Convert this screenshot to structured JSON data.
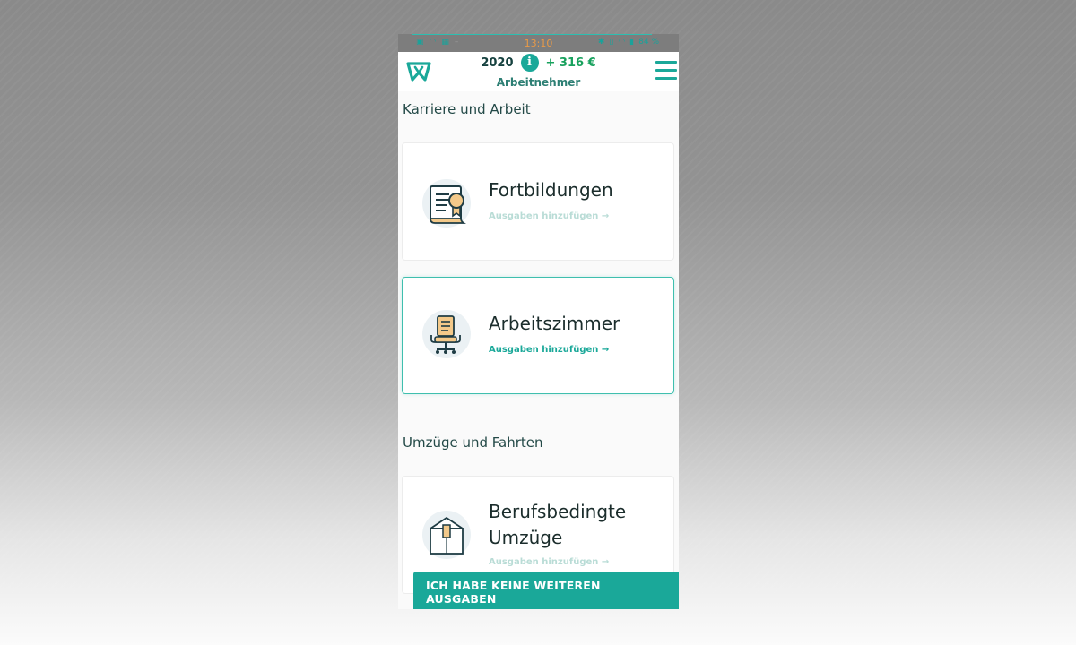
{
  "status_bar": {
    "time": "13:10",
    "left_icons": [
      "image-icon",
      "wifi-icon",
      "sim-icon",
      "dash-icon"
    ],
    "right_icons": [
      "bluetooth-icon",
      "vibrate-icon",
      "wifi-icon",
      "signal-icon",
      "battery-icon"
    ],
    "battery": "84 %"
  },
  "header": {
    "year": "2020",
    "refund": "+ 316 €",
    "subtitle": "Arbeitnehmer",
    "accent_color": "#1aa899"
  },
  "sections": [
    {
      "title": "Karriere und Arbeit",
      "cards": [
        {
          "title": "Fortbildungen",
          "link": "Ausgaben hinzufügen →",
          "icon": "certificate-icon",
          "selected": false
        },
        {
          "title": "Arbeitszimmer",
          "link": "Ausgaben hinzufügen →",
          "icon": "office-chair-icon",
          "selected": true
        }
      ]
    },
    {
      "title": "Umzüge und Fahrten",
      "cards": [
        {
          "title_line1": "Berufsbedingte",
          "title_line2": "Umzüge",
          "link": "Ausgaben hinzufügen →",
          "icon": "moving-box-icon",
          "selected": false
        }
      ]
    }
  ],
  "cta": {
    "label": "ICH HABE KEINE WEITEREN AUSGABEN"
  }
}
